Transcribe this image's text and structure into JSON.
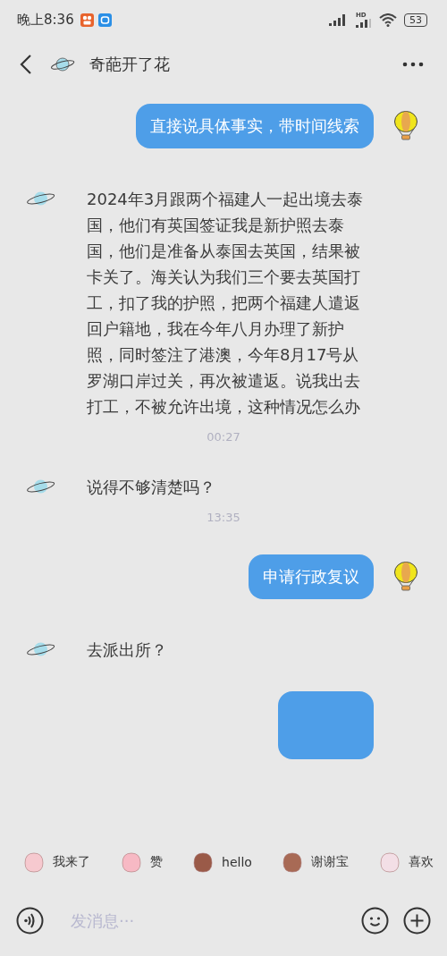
{
  "status_bar": {
    "time": "晚上8:36",
    "hd": "HD",
    "battery": "53"
  },
  "header": {
    "title": "奇葩开了花"
  },
  "messages": [
    {
      "kind": "outgoing",
      "text": "直接说具体事实，带时间线索"
    },
    {
      "kind": "incoming",
      "text": "2024年3月跟两个福建人一起出境去泰国，他们有英国签证我是新护照去泰国，他们是准备从泰国去英国，结果被卡关了。海关认为我们三个要去英国打工，扣了我的护照，把两个福建人遣返回户籍地，我在今年八月办理了新护照，同时签注了港澳，今年8月17号从罗湖口岸过关，再次被遣返。说我出去打工，不被允许出境，这种情况怎么办"
    },
    {
      "kind": "time",
      "text": "00:27"
    },
    {
      "kind": "incoming",
      "text": "说得不够清楚吗？"
    },
    {
      "kind": "time",
      "text": "13:35"
    },
    {
      "kind": "outgoing",
      "text": "申请行政复议"
    },
    {
      "kind": "incoming",
      "text": "去派出所？"
    },
    {
      "kind": "outgoing-clipped"
    }
  ],
  "stickers": [
    {
      "label": "我来了",
      "color": "#f6c9cf"
    },
    {
      "label": "赞",
      "color": "#f7b9c4"
    },
    {
      "label": "hello",
      "color": "#9a5a48"
    },
    {
      "label": "谢谢宝",
      "color": "#a86a55"
    },
    {
      "label": "喜欢",
      "color": "#f3dfe6"
    }
  ],
  "input": {
    "placeholder": "发消息···"
  }
}
